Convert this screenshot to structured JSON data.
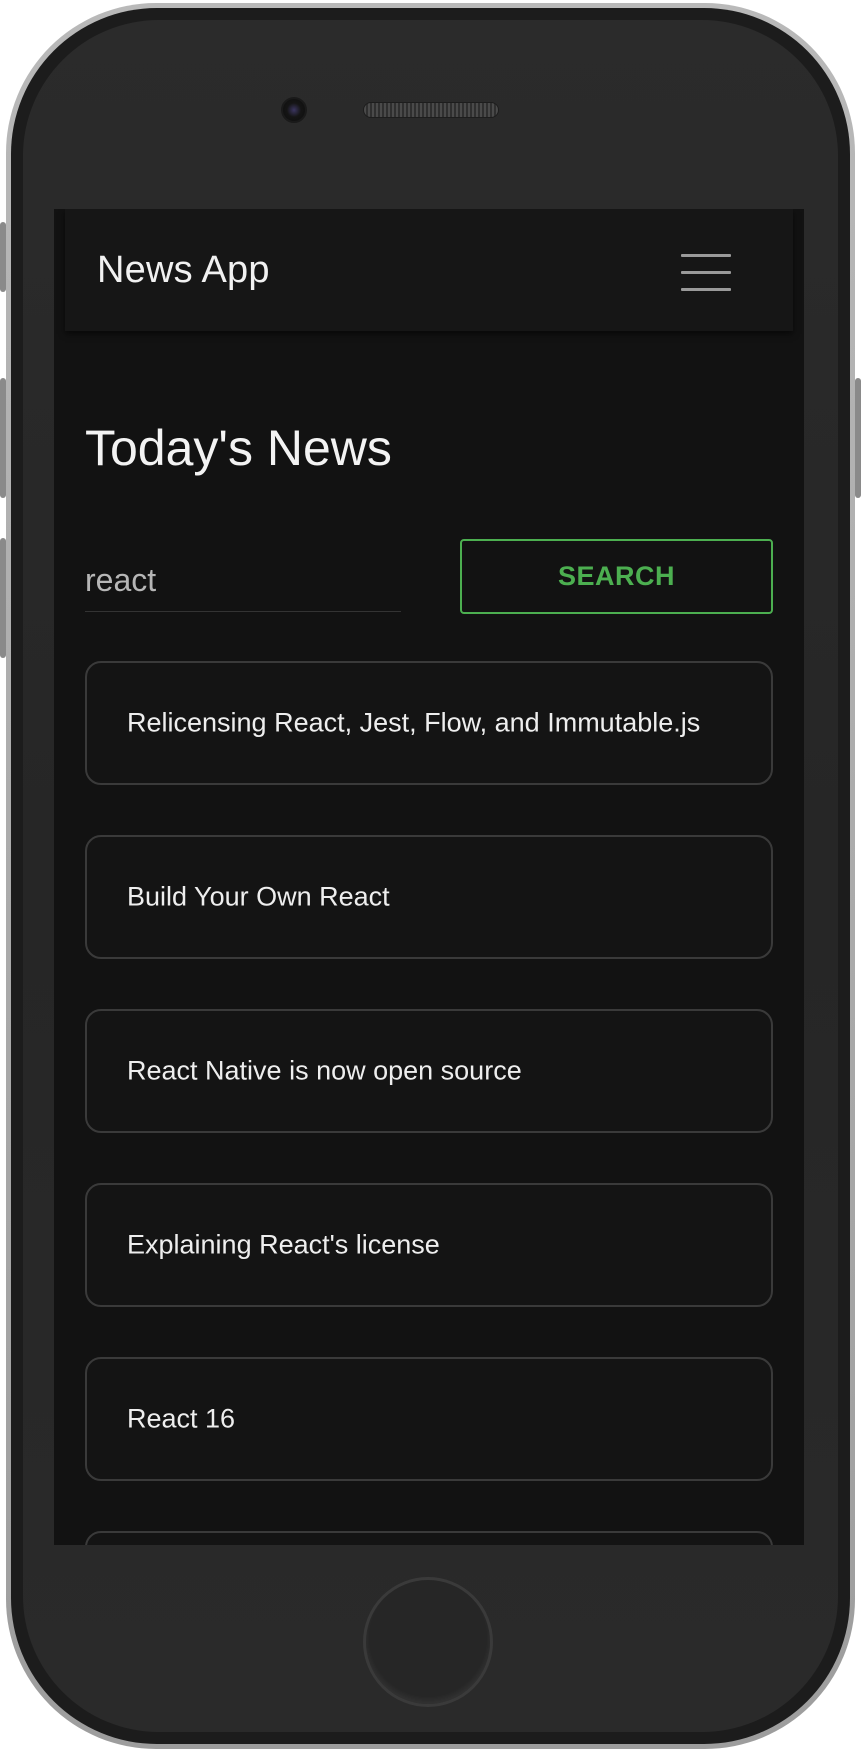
{
  "app": {
    "title": "News App",
    "menu_icon": "hamburger-menu-icon"
  },
  "page": {
    "heading": "Today's News"
  },
  "search": {
    "value": "react",
    "placeholder": "",
    "button_label": "SEARCH"
  },
  "news": {
    "items": [
      {
        "title": "Relicensing React, Jest, Flow, and Immutable.js"
      },
      {
        "title": "Build Your Own React"
      },
      {
        "title": "React Native is now open source"
      },
      {
        "title": "Explaining React's license"
      },
      {
        "title": "React 16"
      },
      {
        "title": ""
      }
    ]
  },
  "colors": {
    "accent": "#4caf50",
    "background": "#121212",
    "appbar": "#161616",
    "card_border": "#3a3a3a",
    "text": "#eeeeee"
  }
}
